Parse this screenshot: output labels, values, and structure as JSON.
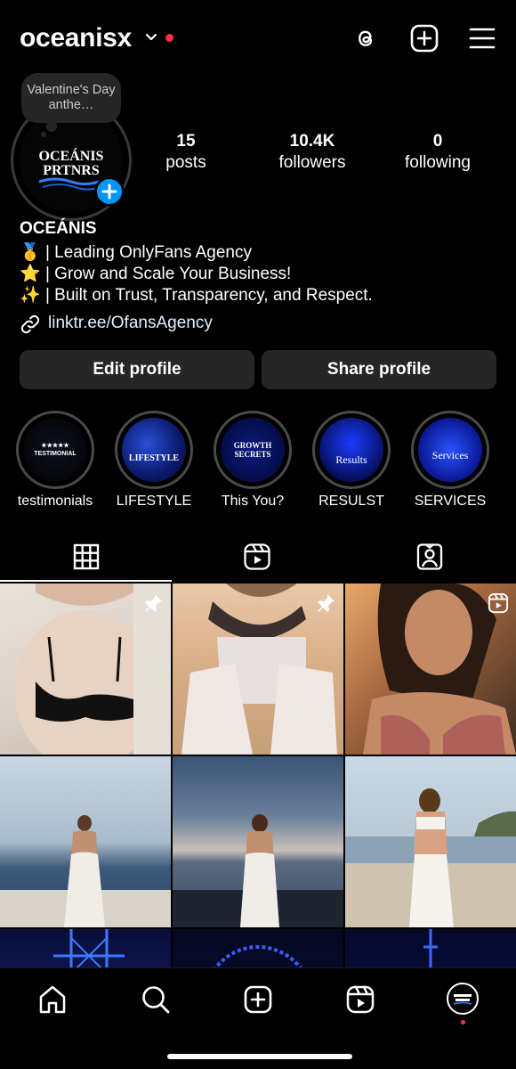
{
  "header": {
    "username": "oceanisx",
    "icons": [
      "threads-icon",
      "create-post-icon",
      "menu-icon"
    ]
  },
  "profile": {
    "note": "Valentine's Day anthe…",
    "avatar_text_line1": "OCEÁNIS",
    "avatar_text_line2": "PRTNRS",
    "stats": [
      {
        "value": "15",
        "label": "posts"
      },
      {
        "value": "10.4K",
        "label": "followers"
      },
      {
        "value": "0",
        "label": "following"
      }
    ],
    "name": "OCEÁNIS",
    "bio": [
      {
        "emoji": "🥇",
        "text": " | Leading OnlyFans Agency"
      },
      {
        "emoji": "⭐",
        "text": " | Grow and Scale Your Business!"
      },
      {
        "emoji": "✨",
        "text": " | Built on Trust, Transparency, and Respect."
      }
    ],
    "link": "linktr.ee/OfansAgency"
  },
  "buttons": {
    "edit": "Edit profile",
    "share": "Share profile"
  },
  "highlights": [
    {
      "label": "testimonials",
      "cover": "★★★★★ TESTIMONIAL"
    },
    {
      "label": "LIFESTYLE",
      "cover": "LIFESTYLE"
    },
    {
      "label": "This You?",
      "cover": "GROWTH SECRETS"
    },
    {
      "label": "RESULST",
      "cover": "Results"
    },
    {
      "label": "SERVICES",
      "cover": "Services"
    }
  ],
  "tabs": [
    "grid-icon",
    "reels-icon",
    "tagged-icon"
  ],
  "colors": {
    "accent_blue": "#0095f6",
    "notification_red": "#ff3040",
    "button_bg": "#262626"
  }
}
